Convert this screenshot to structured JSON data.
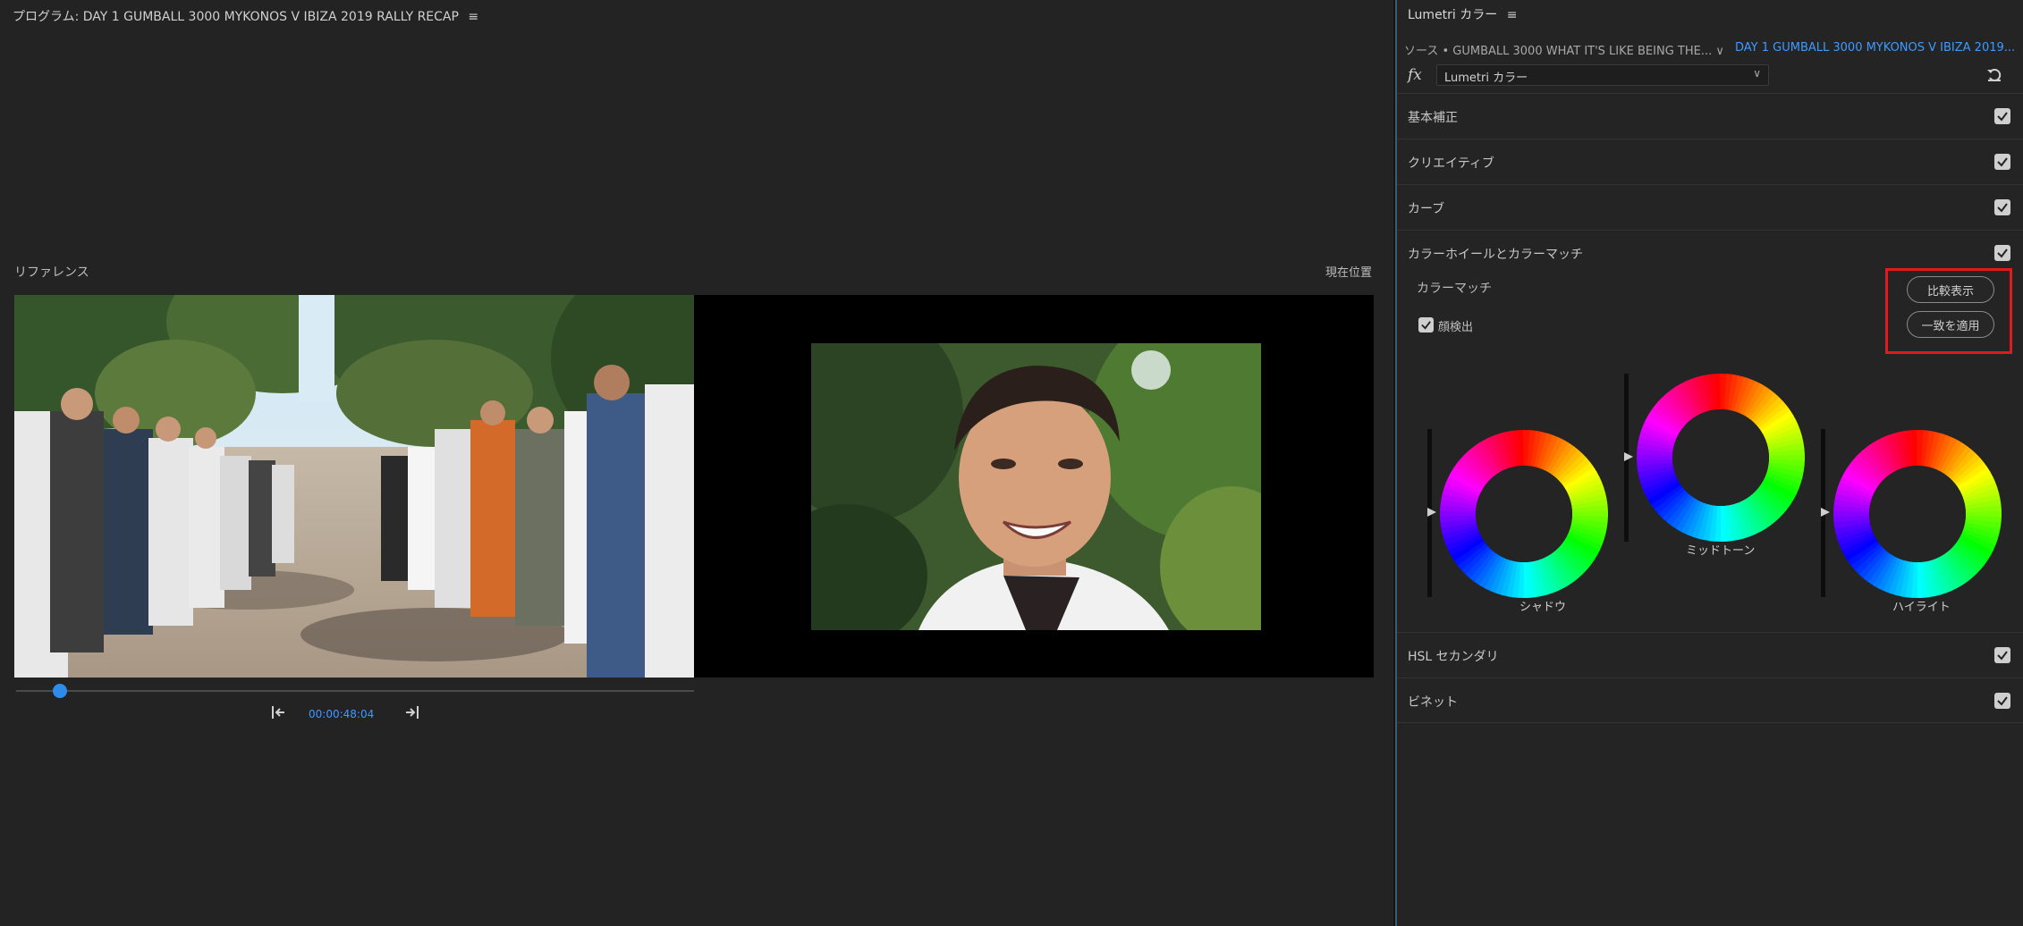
{
  "program": {
    "title": "プログラム: DAY 1 GUMBALL 3000 MYKONOS V IBIZA 2019 RALLY RECAP",
    "menu_glyph": "≡",
    "reference_label": "リファレンス",
    "current_label": "現在位置",
    "timecode": "00:00:48:04",
    "scrub_position_fraction": 0.065
  },
  "lumetri": {
    "title": "Lumetri カラー",
    "menu_glyph": "≡",
    "source_text": "ソース • GUMBALL 3000 WHAT IT'S LIKE BEING THE... ∨",
    "sequence_text": "DAY 1 GUMBALL 3000 MYKONOS V IBIZA 2019...",
    "fx_label": "fx",
    "effect_name": "Lumetri カラー",
    "sections": {
      "basic": "基本補正",
      "creative": "クリエイティブ",
      "curves": "カーブ",
      "wheels": "カラーホイールとカラーマッチ",
      "hsl": "HSL セカンダリ",
      "vignette": "ビネット"
    },
    "color_match": {
      "label": "カラーマッチ",
      "face_detect_label": "顔検出",
      "compare_button": "比較表示",
      "apply_button": "一致を適用"
    },
    "wheels": {
      "shadow": "シャドウ",
      "midtone": "ミッドトーン",
      "highlight": "ハイライト"
    }
  },
  "colors": {
    "accent": "#3d9bff",
    "highlight_box": "#e01b1b",
    "panel_bg": "#242424"
  }
}
